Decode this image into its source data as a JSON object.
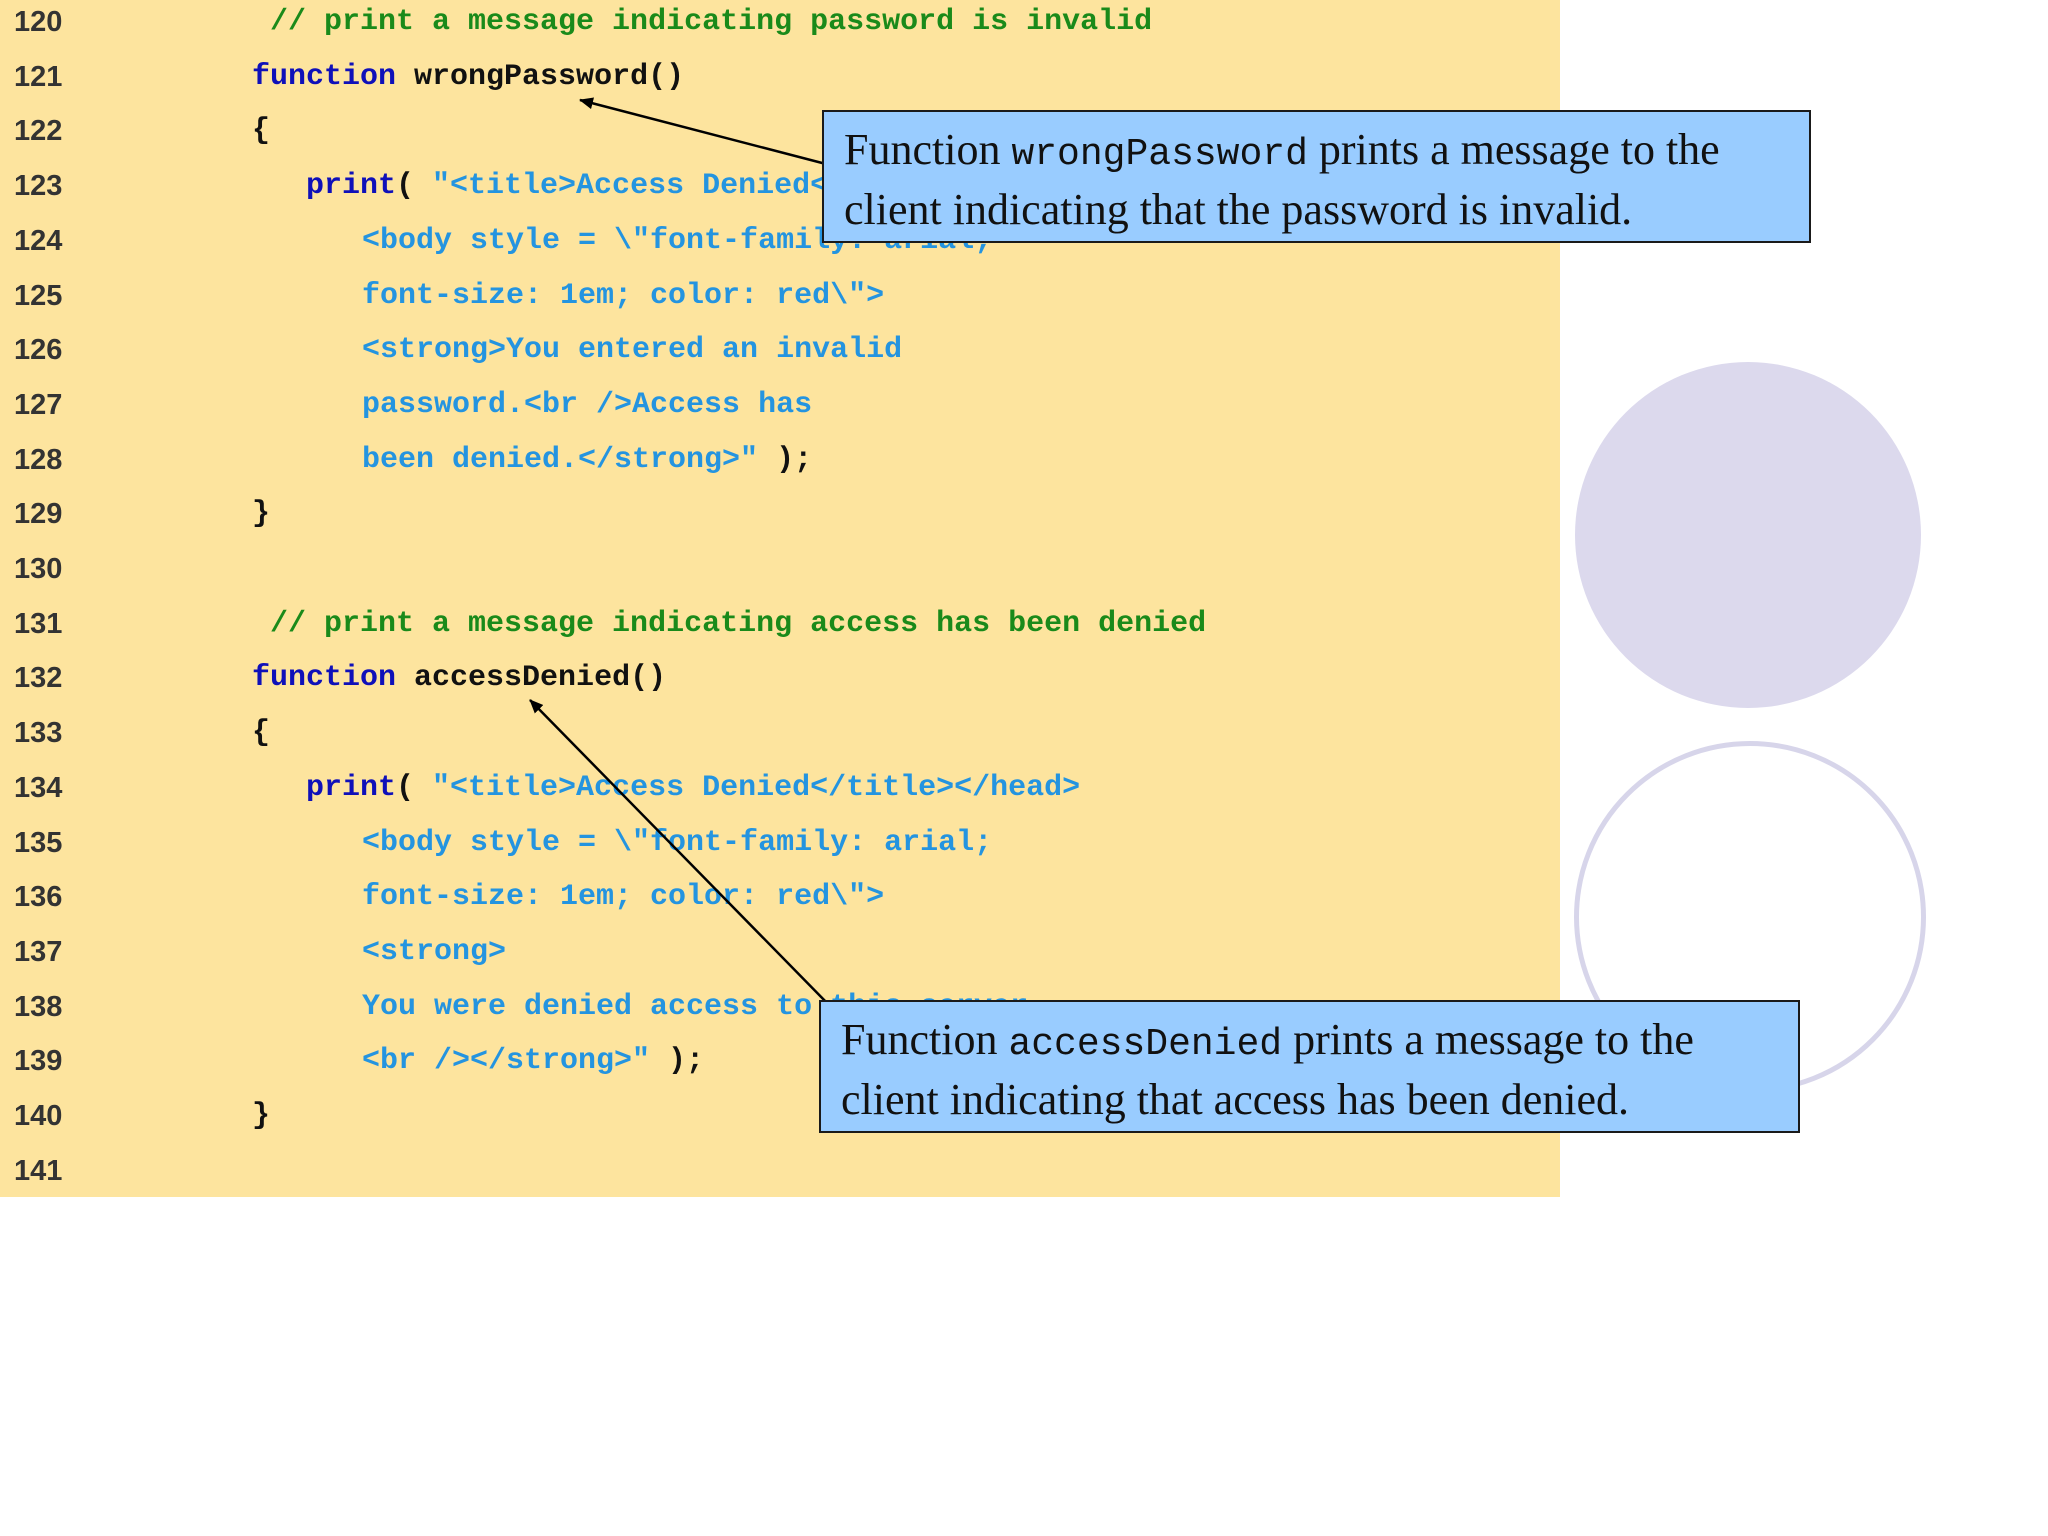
{
  "code_lines": [
    {
      "number": "120",
      "indent": 1,
      "tokens": [
        {
          "type": "comment",
          "text": " // print a message indicating password is invalid"
        }
      ]
    },
    {
      "number": "121",
      "indent": 1,
      "tokens": [
        {
          "type": "keyword",
          "text": "function"
        },
        {
          "type": "plain",
          "text": " wrongPassword()"
        }
      ]
    },
    {
      "number": "122",
      "indent": 1,
      "tokens": [
        {
          "type": "plain",
          "text": "{"
        }
      ]
    },
    {
      "number": "123",
      "indent": 2,
      "tokens": [
        {
          "type": "keyword",
          "text": "print"
        },
        {
          "type": "plain",
          "text": "( "
        },
        {
          "type": "string",
          "text": "\"<title>Access Denied</title></head>"
        }
      ]
    },
    {
      "number": "124",
      "indent": 3,
      "tokens": [
        {
          "type": "string",
          "text": "<body style = \\\"font-family: arial;"
        }
      ]
    },
    {
      "number": "125",
      "indent": 3,
      "tokens": [
        {
          "type": "string",
          "text": "font-size: 1em; color: red\\\">"
        }
      ]
    },
    {
      "number": "126",
      "indent": 3,
      "tokens": [
        {
          "type": "string",
          "text": "<strong>You entered an invalid"
        }
      ]
    },
    {
      "number": "127",
      "indent": 3,
      "tokens": [
        {
          "type": "string",
          "text": "password.<br />Access has"
        }
      ]
    },
    {
      "number": "128",
      "indent": 3,
      "tokens": [
        {
          "type": "string",
          "text": "been denied.</strong>\""
        },
        {
          "type": "plain",
          "text": " );"
        }
      ]
    },
    {
      "number": "129",
      "indent": 1,
      "tokens": [
        {
          "type": "plain",
          "text": "}"
        }
      ]
    },
    {
      "number": "130",
      "indent": 1,
      "tokens": []
    },
    {
      "number": "131",
      "indent": 1,
      "tokens": [
        {
          "type": "comment",
          "text": " // print a message indicating access has been denied"
        }
      ]
    },
    {
      "number": "132",
      "indent": 1,
      "tokens": [
        {
          "type": "keyword",
          "text": "function"
        },
        {
          "type": "plain",
          "text": " accessDenied()"
        }
      ]
    },
    {
      "number": "133",
      "indent": 1,
      "tokens": [
        {
          "type": "plain",
          "text": "{"
        }
      ]
    },
    {
      "number": "134",
      "indent": 2,
      "tokens": [
        {
          "type": "keyword",
          "text": "print"
        },
        {
          "type": "plain",
          "text": "( "
        },
        {
          "type": "string",
          "text": "\"<title>Access Denied</title></head>"
        }
      ]
    },
    {
      "number": "135",
      "indent": 3,
      "tokens": [
        {
          "type": "string",
          "text": "<body style = \\\"font-family: arial;"
        }
      ]
    },
    {
      "number": "136",
      "indent": 3,
      "tokens": [
        {
          "type": "string",
          "text": "font-size: 1em; color: red\\\">"
        }
      ]
    },
    {
      "number": "137",
      "indent": 3,
      "tokens": [
        {
          "type": "string",
          "text": "<strong>"
        }
      ]
    },
    {
      "number": "138",
      "indent": 3,
      "tokens": [
        {
          "type": "string",
          "text": "You were denied access to this server."
        }
      ]
    },
    {
      "number": "139",
      "indent": 3,
      "tokens": [
        {
          "type": "string",
          "text": "<br /></strong>\""
        },
        {
          "type": "plain",
          "text": " );"
        }
      ]
    },
    {
      "number": "140",
      "indent": 1,
      "tokens": [
        {
          "type": "plain",
          "text": "}"
        }
      ]
    },
    {
      "number": "141",
      "indent": 1,
      "tokens": []
    }
  ],
  "callouts": {
    "wrong_password": {
      "prefix": "Function ",
      "code": "wrongPassword",
      "suffix": " prints a message to the client indicating that the password is invalid."
    },
    "access_denied": {
      "prefix": "Function ",
      "code": "accessDenied",
      "suffix": " prints a message to the client indicating that access has been denied."
    }
  },
  "colors": {
    "code_background": "#fde49e",
    "comment": "#1a8a1a",
    "keyword": "#0f10b9",
    "plain": "#111111",
    "string": "#2494e0",
    "callout_background": "#99ccff",
    "decorative_circle": "#dcd9ed"
  }
}
